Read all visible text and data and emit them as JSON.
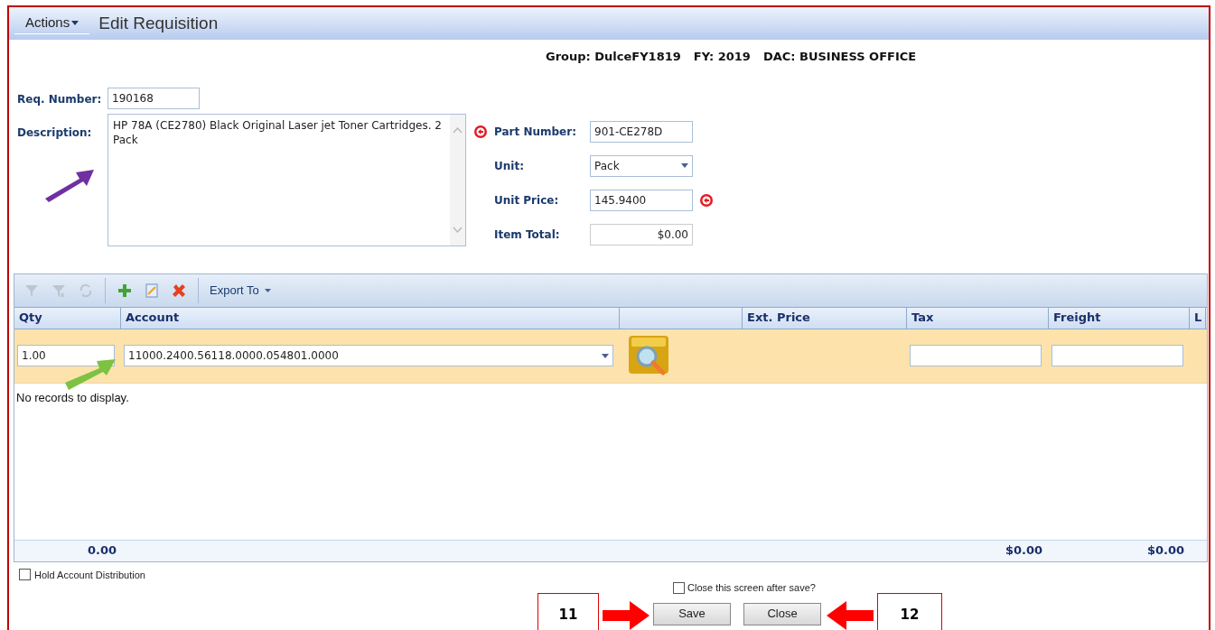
{
  "header": {
    "menu": "Actions",
    "title": "Edit Requisition"
  },
  "context": {
    "group": "Group: DulceFY1819",
    "fy": "FY: 2019",
    "dac": "DAC: BUSINESS OFFICE"
  },
  "form": {
    "req_number": {
      "label": "Req. Number:",
      "value": "190168"
    },
    "description": {
      "label": "Description:",
      "value": "HP 78A (CE2780) Black Original Laser jet Toner Cartridges. 2 Pack"
    },
    "part_number": {
      "label": "Part Number:",
      "value": "901-CE278D"
    },
    "unit": {
      "label": "Unit:",
      "value": "Pack"
    },
    "unit_price": {
      "label": "Unit Price:",
      "value": "145.9400"
    },
    "item_total": {
      "label": "Item Total:",
      "value": "$0.00"
    }
  },
  "grid": {
    "toolbar": [
      {
        "kind": "filter",
        "disabled": true
      },
      {
        "kind": "clear-filter",
        "disabled": true
      },
      {
        "kind": "refresh",
        "disabled": true
      },
      {
        "kind": "add",
        "disabled": false
      },
      {
        "kind": "edit",
        "disabled": false
      },
      {
        "kind": "delete",
        "disabled": false
      }
    ],
    "export": "Export To",
    "columns": [
      {
        "label": "Qty"
      },
      {
        "label": "Account"
      },
      {},
      {
        "label": "Ext. Price"
      },
      {
        "label": "Tax"
      },
      {
        "label": "Freight"
      },
      {
        "label": "L"
      }
    ],
    "edit_row": {
      "qty": "1.00",
      "account": "11000.2400.56118.0000.054801.0000"
    },
    "empty": "No records to display.",
    "footer": {
      "qty": "0.00",
      "tax": "$0.00",
      "freight": "$0.00"
    }
  },
  "hold_distribution": {
    "label": "Hold Account Distribution",
    "checked": false
  },
  "close_after_save": {
    "label": "Close this screen after save?",
    "checked": false
  },
  "buttons": [
    {
      "label": "Save"
    },
    {
      "label": "Close"
    }
  ],
  "callouts": [
    {
      "label": "11"
    },
    {
      "label": "12"
    }
  ]
}
